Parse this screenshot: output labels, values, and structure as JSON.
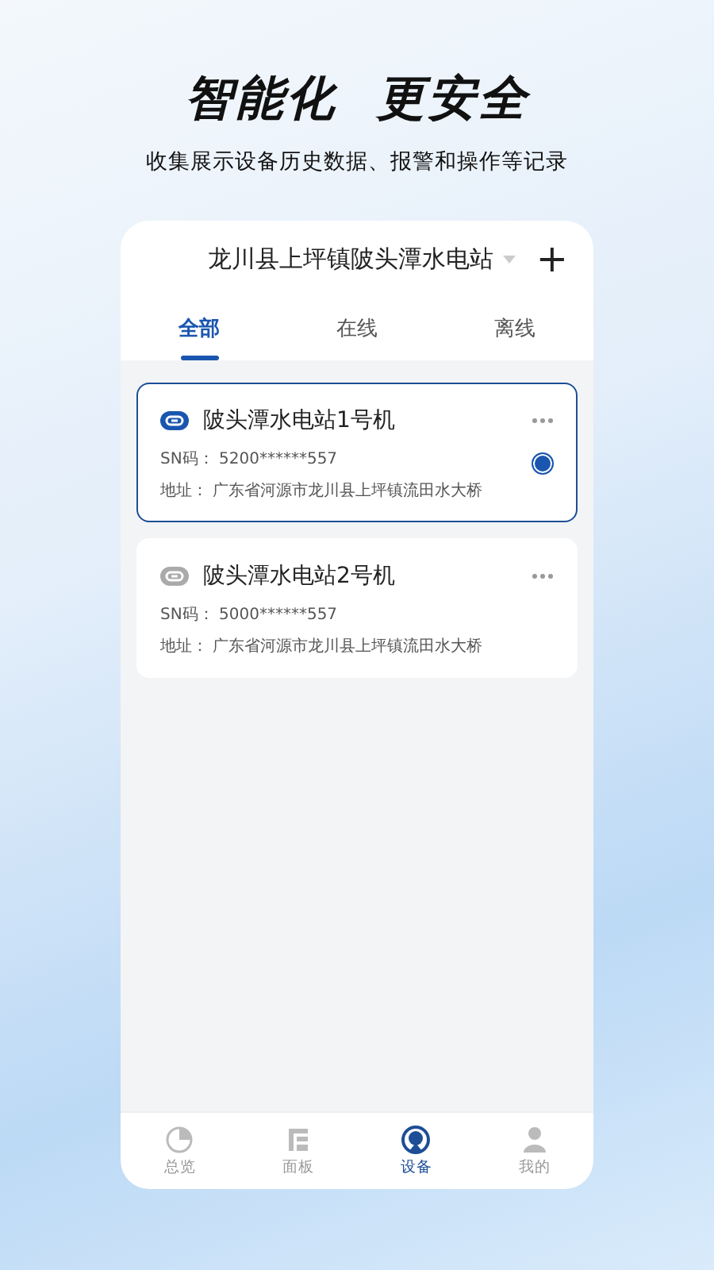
{
  "headline": "智能化  更安全",
  "subtitle": "收集展示设备历史数据、报警和操作等记录",
  "station": {
    "title": "龙川县上坪镇陂头潭水电站",
    "add": "+"
  },
  "tabs": [
    {
      "label": "全部",
      "selected": true
    },
    {
      "label": "在线",
      "selected": false
    },
    {
      "label": "离线",
      "selected": false
    }
  ],
  "devices": [
    {
      "name": "陂头潭水电站1号机",
      "online": true,
      "selected": true,
      "sn_label": "SN码：",
      "sn": "5200******557",
      "addr_label": "地址：",
      "address": "广东省河源市龙川县上坪镇流田水大桥"
    },
    {
      "name": "陂头潭水电站2号机",
      "online": false,
      "selected": false,
      "sn_label": "SN码：",
      "sn": "5000******557",
      "addr_label": "地址：",
      "address": "广东省河源市龙川县上坪镇流田水大桥"
    }
  ],
  "nav": [
    {
      "label": "总览",
      "kind": "overview",
      "selected": false
    },
    {
      "label": "面板",
      "kind": "panel",
      "selected": false
    },
    {
      "label": "设备",
      "kind": "device",
      "selected": true
    },
    {
      "label": "我的",
      "kind": "profile",
      "selected": false
    }
  ]
}
